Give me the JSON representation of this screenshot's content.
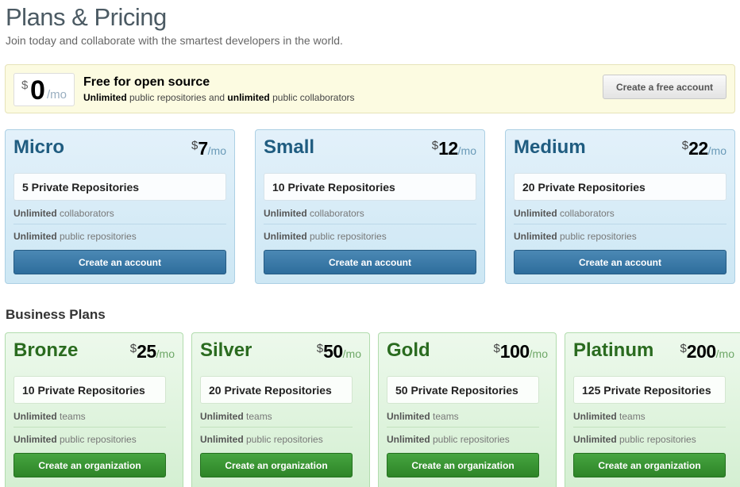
{
  "header": {
    "title": "Plans & Pricing",
    "subtitle": "Join today and collaborate with the smartest developers in the world."
  },
  "free_plan": {
    "currency": "$",
    "amount": "0",
    "period": "/mo",
    "title": "Free for open source",
    "desc_part1": "Unlimited",
    "desc_part2": " public repositories and ",
    "desc_part3": "unlimited",
    "desc_part4": " public collaborators",
    "button_label": "Create a free account"
  },
  "personal_plans": [
    {
      "name": "Micro",
      "currency": "$",
      "amount": "7",
      "period": "/mo",
      "repos": "5 Private Repositories",
      "feat1_bold": "Unlimited",
      "feat1_rest": " collaborators",
      "feat2_bold": "Unlimited",
      "feat2_rest": " public repositories",
      "button_label": "Create an account"
    },
    {
      "name": "Small",
      "currency": "$",
      "amount": "12",
      "period": "/mo",
      "repos": "10 Private Repositories",
      "feat1_bold": "Unlimited",
      "feat1_rest": " collaborators",
      "feat2_bold": "Unlimited",
      "feat2_rest": " public repositories",
      "button_label": "Create an account"
    },
    {
      "name": "Medium",
      "currency": "$",
      "amount": "22",
      "period": "/mo",
      "repos": "20 Private Repositories",
      "feat1_bold": "Unlimited",
      "feat1_rest": " collaborators",
      "feat2_bold": "Unlimited",
      "feat2_rest": " public repositories",
      "button_label": "Create an account"
    }
  ],
  "business_section": {
    "title": "Business Plans"
  },
  "business_plans": [
    {
      "name": "Bronze",
      "currency": "$",
      "amount": "25",
      "period": "/mo",
      "repos": "10 Private Repositories",
      "feat1_bold": "Unlimited",
      "feat1_rest": " teams",
      "feat2_bold": "Unlimited",
      "feat2_rest": " public repositories",
      "button_label": "Create an organization"
    },
    {
      "name": "Silver",
      "currency": "$",
      "amount": "50",
      "period": "/mo",
      "repos": "20 Private Repositories",
      "feat1_bold": "Unlimited",
      "feat1_rest": " teams",
      "feat2_bold": "Unlimited",
      "feat2_rest": " public repositories",
      "button_label": "Create an organization"
    },
    {
      "name": "Gold",
      "currency": "$",
      "amount": "100",
      "period": "/mo",
      "repos": "50 Private Repositories",
      "feat1_bold": "Unlimited",
      "feat1_rest": " teams",
      "feat2_bold": "Unlimited",
      "feat2_rest": " public repositories",
      "button_label": "Create an organization"
    },
    {
      "name": "Platinum",
      "currency": "$",
      "amount": "200",
      "period": "/mo",
      "repos": "125 Private Repositories",
      "feat1_bold": "Unlimited",
      "feat1_rest": " teams",
      "feat2_bold": "Unlimited",
      "feat2_rest": " public repositories",
      "button_label": "Create an organization"
    }
  ],
  "colors": {
    "personal_button": "#2e6d9c",
    "business_button": "#2d8427",
    "personal_name": "#1f5c80",
    "business_name": "#2a6b1f",
    "free_banner_bg": "#fcfbe1"
  }
}
